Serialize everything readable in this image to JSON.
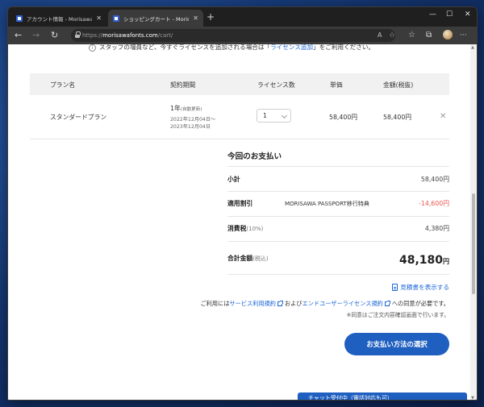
{
  "browser": {
    "tabs": [
      {
        "title": "アカウント情報 - Morisawa ID"
      },
      {
        "title": "ショッピングカート - Morisawa Fonts"
      }
    ],
    "new_tab": "+",
    "close_glyph": "✕",
    "url_prefix": "https://",
    "url_host": "morisawafonts.com",
    "url_path": "/cart/",
    "nav": {
      "back": "←",
      "forward": "→",
      "reload": "↻"
    },
    "window_controls": {
      "minimize": "—",
      "maximize": "☐",
      "close": "✕"
    },
    "toolbar_icons": [
      "read-aloud-icon",
      "favorite-add-icon",
      "favorites-icon",
      "collections-icon",
      "profile-avatar",
      "more-icon"
    ],
    "more_glyph": "···"
  },
  "notice": {
    "text_before": "スタッフの増員など、今すぐライセンスを追加される場合は「",
    "link": "ライセンス追加",
    "text_after": "」をご利用ください。"
  },
  "table": {
    "headers": [
      "プラン名",
      "契約期間",
      "ライセンス数",
      "単価",
      "金額(税抜)"
    ],
    "row": {
      "plan": "スタンダードプラン",
      "period_main": "1年",
      "period_sub": "(自動更新)",
      "period_from": "2022年12月04日～",
      "period_to": "2023年12月04日",
      "quantity": "1",
      "unit_price": "58,400円",
      "amount": "58,400円",
      "remove": "✕"
    }
  },
  "summary": {
    "title": "今回のお支払い",
    "subtotal_label": "小計",
    "subtotal_value": "58,400円",
    "discount_label": "適用割引",
    "discount_name": "MORISAWA PASSPORT移行特典",
    "discount_value": "-14,600円",
    "tax_label": "消費税",
    "tax_note": "(10%)",
    "tax_value": "4,380円",
    "total_label": "合計金額",
    "total_note": "(税込)",
    "total_value": "48,180",
    "total_unit": "円"
  },
  "estimate_link": "見積書を表示する",
  "terms": {
    "prefix": "ご利用には",
    "link1": "サービス利用規約",
    "middle": "および",
    "link2": "エンドユーザーライセンス規約",
    "suffix": "への同意が必要です。",
    "note": "※同意はご注文内容確認画面で行います。"
  },
  "pay_button": "お支払い方法の選択",
  "chat": "チャット受付中（電話対応も可）",
  "colors": {
    "accent": "#1f5fc0",
    "link": "#1a64d6",
    "discount": "#e8554e"
  }
}
